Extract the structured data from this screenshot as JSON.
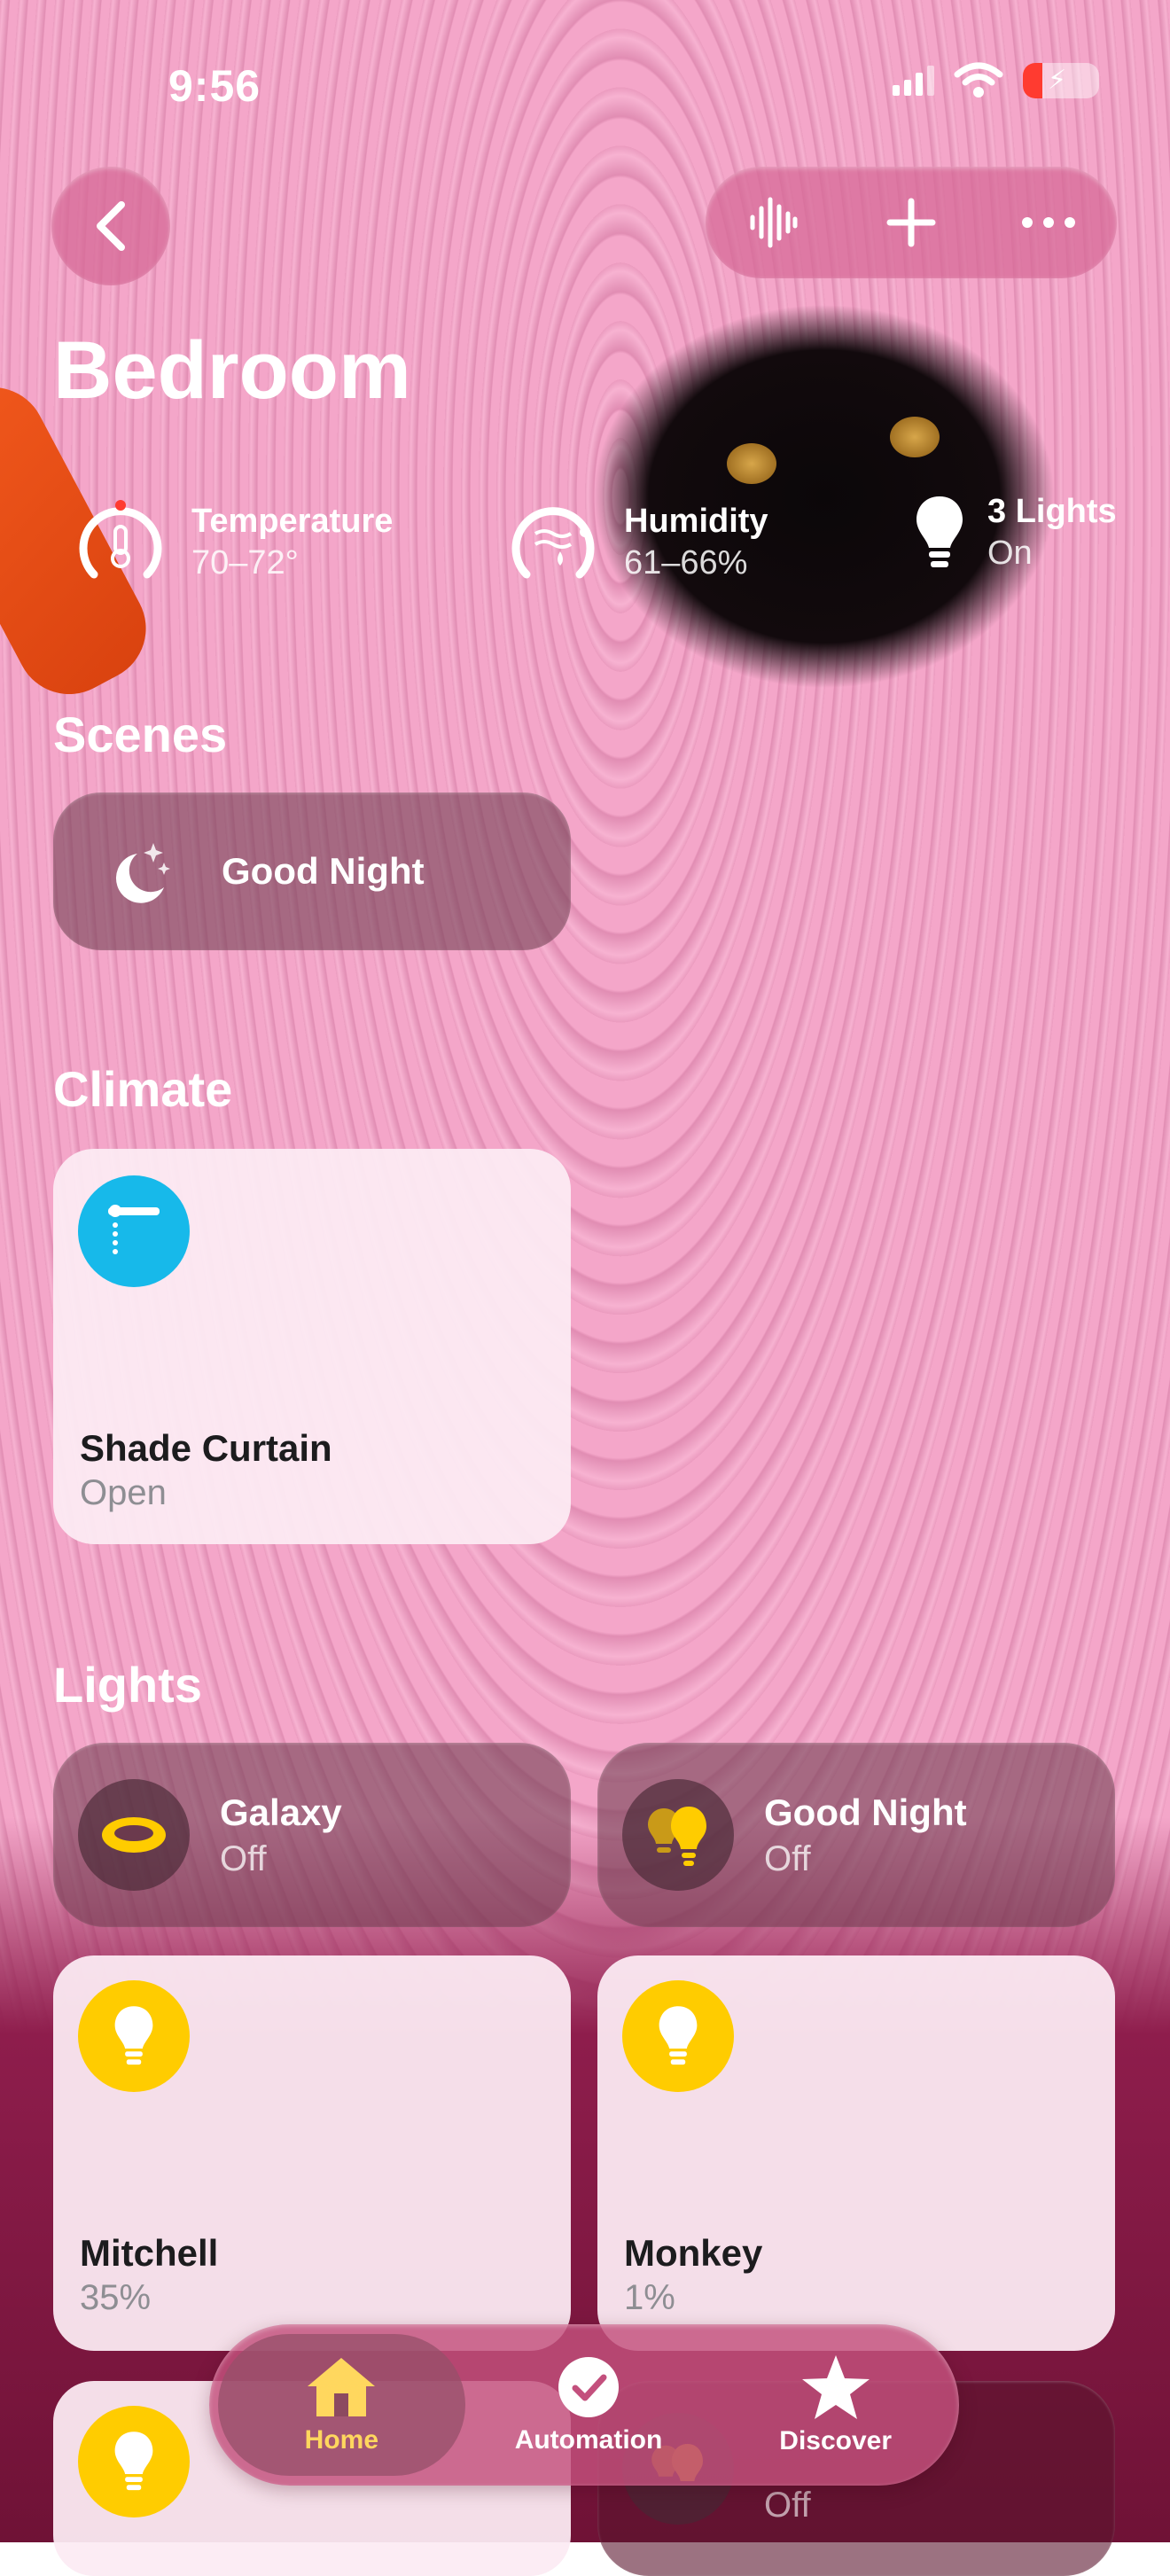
{
  "status_bar": {
    "time": "9:56"
  },
  "header": {
    "title": "Bedroom"
  },
  "stats": [
    {
      "label": "Temperature",
      "value": "70–72°",
      "icon": "thermometer-gauge-icon"
    },
    {
      "label": "Humidity",
      "value": "61–66%",
      "icon": "humidity-gauge-icon"
    },
    {
      "label": "3 Lights",
      "value": "On",
      "icon": "lightbulb-icon"
    }
  ],
  "sections": {
    "scenes": "Scenes",
    "climate": "Climate",
    "lights": "Lights"
  },
  "scenes": [
    {
      "label": "Good Night",
      "icon": "moon-stars-icon"
    }
  ],
  "climate": [
    {
      "name": "Shade Curtain",
      "status": "Open",
      "icon": "curtain-icon",
      "color": "#17b9ea"
    }
  ],
  "lights_row1": [
    {
      "name": "Galaxy",
      "status": "Off",
      "icon": "ring-lamp-icon"
    },
    {
      "name": "Good Night",
      "status": "Off",
      "icon": "bulbs-pair-icon"
    }
  ],
  "lights_row2": [
    {
      "name": "Mitchell",
      "status": "35%",
      "icon": "lightbulb-icon"
    },
    {
      "name": "Monkey",
      "status": "1%",
      "icon": "lightbulb-icon"
    }
  ],
  "lights_row3": [
    {
      "name": "",
      "status": "",
      "icon": "lightbulb-icon"
    },
    {
      "name": "",
      "status": "Off",
      "icon": "bulbs-pair-icon"
    }
  ],
  "tabs": [
    {
      "label": "Home",
      "icon": "house-icon",
      "active": true
    },
    {
      "label": "Automation",
      "icon": "clock-check-icon",
      "active": false
    },
    {
      "label": "Discover",
      "icon": "star-icon",
      "active": false
    }
  ],
  "colors": {
    "accent_yellow": "#ffcc00",
    "accent_cyan": "#17b9ea",
    "battery_red": "#ff3b30",
    "tab_active": "#ffd75e"
  }
}
